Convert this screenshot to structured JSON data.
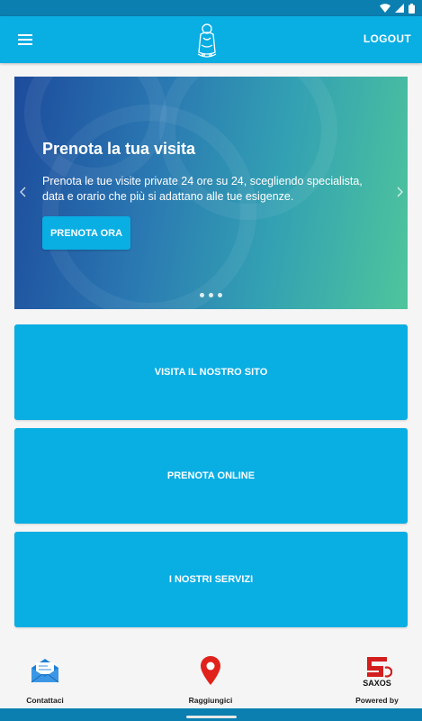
{
  "app_bar": {
    "logout_label": "LOGOUT"
  },
  "carousel": {
    "title": "Prenota la tua visita",
    "text": "Prenota le tue visite private 24 ore su 24, scegliendo specialista, data e orario che più si adattano alle tue esigenze.",
    "cta_label": "PRENOTA ORA",
    "slides_count": 3,
    "active_slide": 1
  },
  "actions": [
    {
      "label": "VISITA IL NOSTRO SITO"
    },
    {
      "label": "PRENOTA ONLINE"
    },
    {
      "label": "I NOSTRI SERVIZI"
    }
  ],
  "bottom_nav": {
    "contact_label": "Contattaci",
    "reach_label": "Raggiungici",
    "powered_label": "Powered by",
    "powered_brand": "SAXOS"
  },
  "icons": {
    "menu": "hamburger-icon",
    "logo": "madonna-logo-icon",
    "prev": "chevron-left-icon",
    "next": "chevron-right-icon",
    "contact": "envelope-icon",
    "reach": "map-pin-icon",
    "powered": "saxos-logo-icon",
    "wifi": "wifi-icon",
    "battery": "battery-icon"
  },
  "colors": {
    "primary": "#09aee3",
    "status_bar": "#0a7fb0",
    "pin_red": "#e0221b"
  }
}
